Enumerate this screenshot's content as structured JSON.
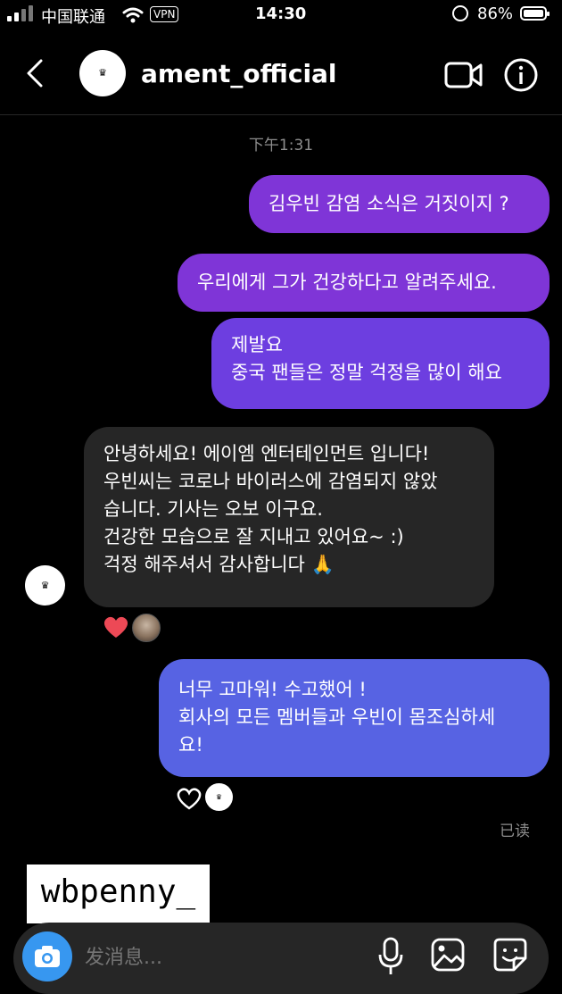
{
  "status_bar": {
    "carrier": "中国联通",
    "vpn": "VPN",
    "time": "14:30",
    "battery": "86%"
  },
  "header": {
    "username": "ament_official",
    "back_icon": "chevron-left-icon",
    "video_icon": "video-call-icon",
    "info_icon": "info-icon"
  },
  "chat": {
    "timestamp": "下午1:31",
    "messages": [
      {
        "from": "me",
        "text": "김우빈 감염 소식은 거짓이지 ?"
      },
      {
        "from": "me",
        "text": "우리에게 그가 건강하다고 알려주세요."
      },
      {
        "from": "me",
        "text": "제발요\n중국 팬들은 정말 걱정을 많이 해요"
      },
      {
        "from": "them",
        "text": "안녕하세요! 에이엠 엔터테인먼트 입니다!\n우빈씨는 코로나 바이러스에 감염되지 않았\n습니다. 기사는 오보 이구요.\n건강한 모습으로 잘 지내고 있어요~ :)\n걱정 해주셔서 감사합니다 🙏"
      },
      {
        "from": "me",
        "text": "너무 고마워! 수고했어 !\n회사의 모든 멤버들과 우빈이 몸조심하세\n요!"
      }
    ],
    "read_status": "已读"
  },
  "watermark": "wbpenny_",
  "input": {
    "placeholder": "发消息..."
  },
  "colors": {
    "bubble_purple": "#7f35d7",
    "bubble_violet": "#6d3ee0",
    "bubble_blue": "#5763e3",
    "bubble_gray": "#262626",
    "heart_red": "#ed4956"
  }
}
